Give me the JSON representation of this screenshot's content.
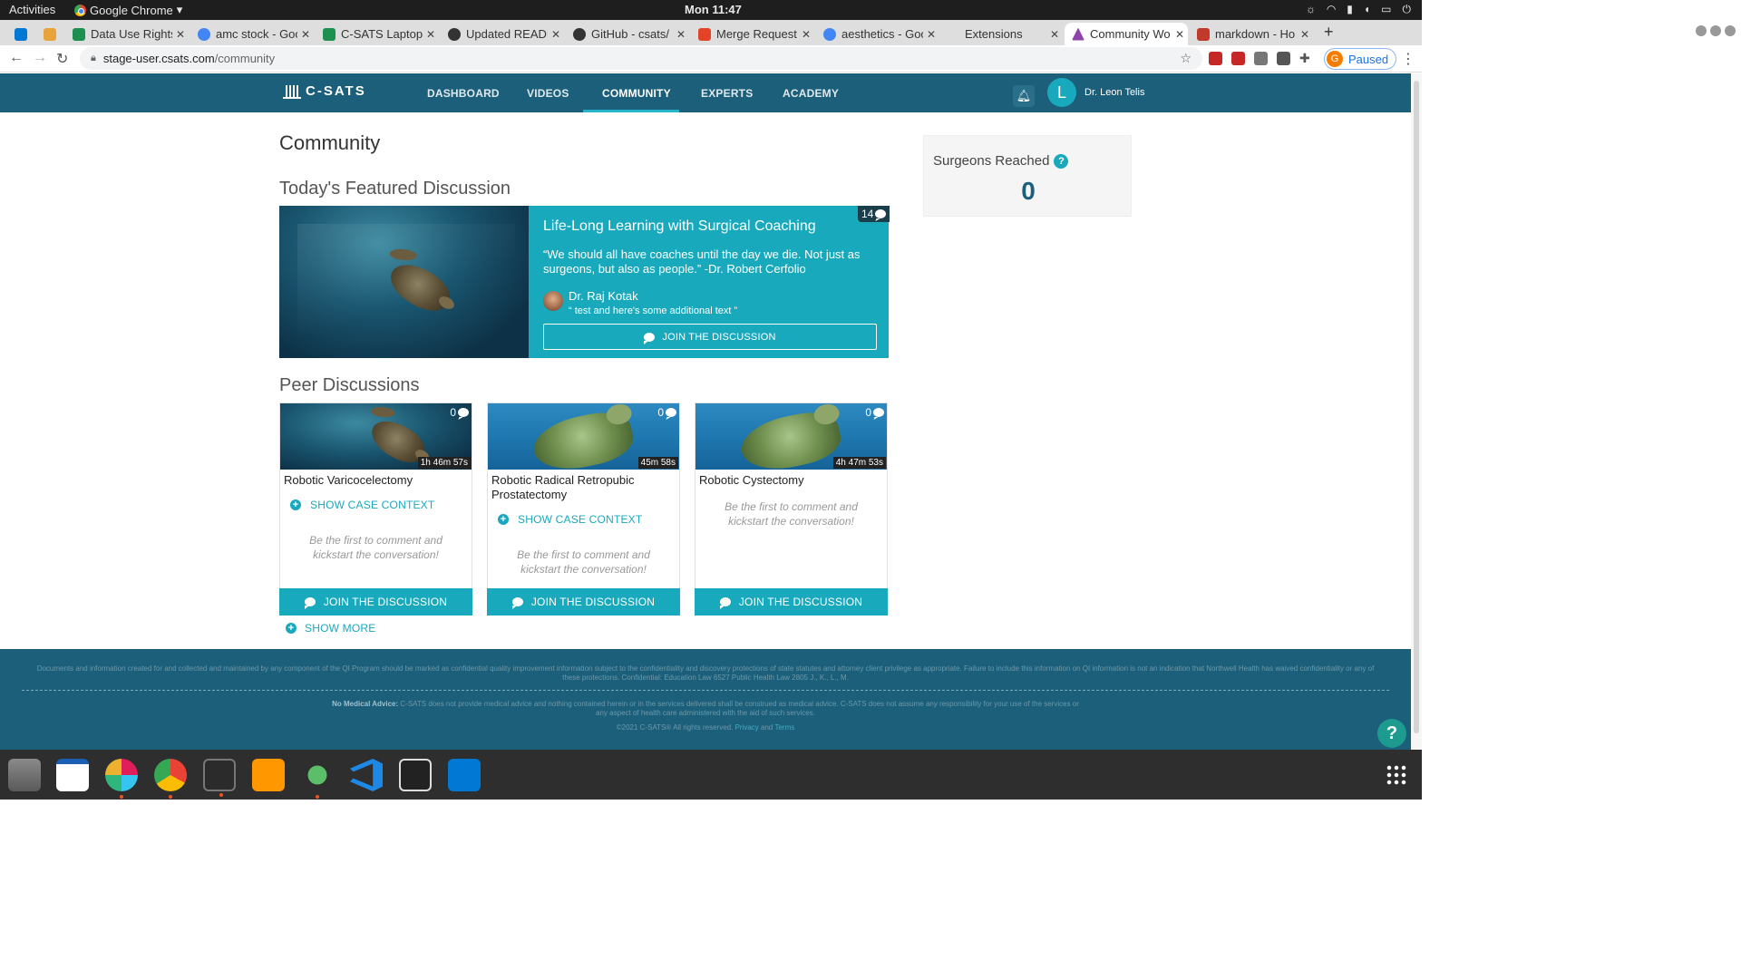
{
  "os": {
    "activities": "Activities",
    "app_name": "Google Chrome",
    "clock": "Mon 11:47"
  },
  "browser": {
    "tabs": [
      {
        "title": "",
        "icon_color": "#0078d4"
      },
      {
        "title": "",
        "icon_color": "#e8a33a"
      },
      {
        "title": "Data Use Rights",
        "icon_color": "#1d8f4e"
      },
      {
        "title": "amc stock - Goo",
        "icon_color": "#4285f4"
      },
      {
        "title": "C-SATS Laptops",
        "icon_color": "#1d8f4e"
      },
      {
        "title": "Updated READM",
        "icon_color": "#333333"
      },
      {
        "title": "GitHub - csats/",
        "icon_color": "#333333"
      },
      {
        "title": "Merge Request",
        "icon_color": "#e24329"
      },
      {
        "title": "aesthetics - Goo",
        "icon_color": "#4285f4"
      },
      {
        "title": "Extensions",
        "icon_color": "#dedede"
      },
      {
        "title": "Community Wo",
        "icon_color": "#8e44ad"
      },
      {
        "title": "markdown - Ho",
        "icon_color": "#c0392b"
      }
    ],
    "active_tab_index": 10,
    "url_host": "stage-user.csats.com",
    "url_path": "/community",
    "profile_initial": "G",
    "profile_status": "Paused"
  },
  "site": {
    "logo_text": "C-SATS",
    "nav": [
      "DASHBOARD",
      "VIDEOS",
      "COMMUNITY",
      "EXPERTS",
      "ACADEMY"
    ],
    "active_nav": "COMMUNITY",
    "user_initial": "L",
    "user_name": "Dr. Leon Telis",
    "accent_color": "#18a9bd",
    "header_color": "#1b5f7a"
  },
  "page": {
    "title": "Community",
    "featured_heading": "Today's Featured Discussion",
    "featured": {
      "title": "Life-Long Learning with Surgical Coaching",
      "quote": "“We should all have coaches until the day we die. Not just as surgeons, but also as people.” -Dr. Robert Cerfolio",
      "comment_count": "14",
      "author": "Dr. Raj Kotak",
      "author_comment": "“ test and here's some additional text ”",
      "join_label": "JOIN THE DISCUSSION"
    },
    "peer_heading": "Peer Discussions",
    "cards": [
      {
        "title": "Robotic Varicocelectomy",
        "comments": "0",
        "duration": "1h 46m 57s",
        "context": "SHOW CASE CONTEXT",
        "empty": "Be the first to comment and kickstart the conversation!",
        "join": "JOIN THE DISCUSSION"
      },
      {
        "title": "Robotic Radical Retropubic Prostatectomy",
        "comments": "0",
        "duration": "45m 58s",
        "context": "SHOW CASE CONTEXT",
        "empty": "Be the first to comment and kickstart the conversation!",
        "join": "JOIN THE DISCUSSION"
      },
      {
        "title": "Robotic Cystectomy",
        "comments": "0",
        "duration": "4h 47m 53s",
        "empty": "Be the first to comment and kickstart the conversation!",
        "join": "JOIN THE DISCUSSION"
      }
    ],
    "show_more": "SHOW MORE",
    "surgeons_label": "Surgeons Reached",
    "surgeons_value": "0"
  },
  "footer": {
    "disclaimer": "Documents and information created for and collected and maintained by any component of the QI Program should be marked as confidential quality improvement information subject to the confidentiality and discovery protections of state statutes and attorney client privilege as appropriate. Failure to include this information on QI information is not an indication that Northwell Health has waived confidentiality or any of these protections. Confidential: Education Law 6527 Public Health Law 2805 J., K., L., M.",
    "no_advice_label": "No Medical Advice:",
    "no_advice_text": "C-SATS does not provide medical advice and nothing contained herein or in the services delivered shall be construed as medical advice. C-SATS does not assume any responsibility for your use of the services or any aspect of health care administered with the aid of such services.",
    "copyright": "©2021 C-SATS® All rights reserved.",
    "privacy": "Privacy",
    "and": "and",
    "terms": "Terms"
  },
  "dock": {
    "apps": [
      "files-icon",
      "writer-icon",
      "slack-icon",
      "chrome-icon",
      "terminal-icon",
      "sublime-icon",
      "rocket-icon",
      "vscode-icon",
      "monitor-icon",
      "outlook-icon"
    ]
  }
}
